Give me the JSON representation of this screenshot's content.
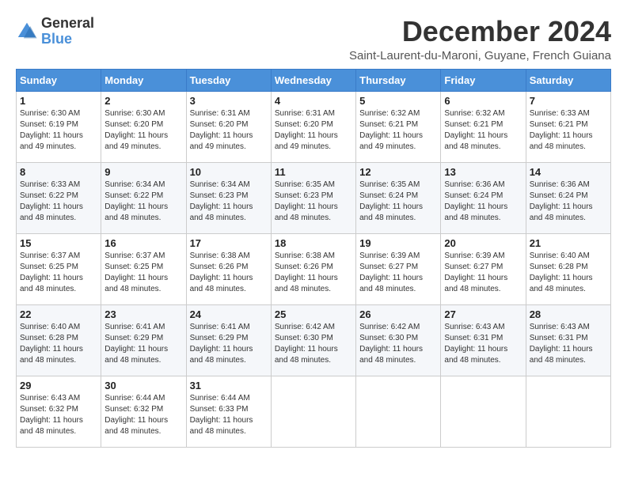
{
  "logo": {
    "general": "General",
    "blue": "Blue"
  },
  "title": "December 2024",
  "subtitle": "Saint-Laurent-du-Maroni, Guyane, French Guiana",
  "days_of_week": [
    "Sunday",
    "Monday",
    "Tuesday",
    "Wednesday",
    "Thursday",
    "Friday",
    "Saturday"
  ],
  "weeks": [
    [
      {
        "day": "1",
        "sunrise": "6:30 AM",
        "sunset": "6:19 PM",
        "daylight": "11 hours and 49 minutes."
      },
      {
        "day": "2",
        "sunrise": "6:30 AM",
        "sunset": "6:20 PM",
        "daylight": "11 hours and 49 minutes."
      },
      {
        "day": "3",
        "sunrise": "6:31 AM",
        "sunset": "6:20 PM",
        "daylight": "11 hours and 49 minutes."
      },
      {
        "day": "4",
        "sunrise": "6:31 AM",
        "sunset": "6:20 PM",
        "daylight": "11 hours and 49 minutes."
      },
      {
        "day": "5",
        "sunrise": "6:32 AM",
        "sunset": "6:21 PM",
        "daylight": "11 hours and 49 minutes."
      },
      {
        "day": "6",
        "sunrise": "6:32 AM",
        "sunset": "6:21 PM",
        "daylight": "11 hours and 48 minutes."
      },
      {
        "day": "7",
        "sunrise": "6:33 AM",
        "sunset": "6:21 PM",
        "daylight": "11 hours and 48 minutes."
      }
    ],
    [
      {
        "day": "8",
        "sunrise": "6:33 AM",
        "sunset": "6:22 PM",
        "daylight": "11 hours and 48 minutes."
      },
      {
        "day": "9",
        "sunrise": "6:34 AM",
        "sunset": "6:22 PM",
        "daylight": "11 hours and 48 minutes."
      },
      {
        "day": "10",
        "sunrise": "6:34 AM",
        "sunset": "6:23 PM",
        "daylight": "11 hours and 48 minutes."
      },
      {
        "day": "11",
        "sunrise": "6:35 AM",
        "sunset": "6:23 PM",
        "daylight": "11 hours and 48 minutes."
      },
      {
        "day": "12",
        "sunrise": "6:35 AM",
        "sunset": "6:24 PM",
        "daylight": "11 hours and 48 minutes."
      },
      {
        "day": "13",
        "sunrise": "6:36 AM",
        "sunset": "6:24 PM",
        "daylight": "11 hours and 48 minutes."
      },
      {
        "day": "14",
        "sunrise": "6:36 AM",
        "sunset": "6:24 PM",
        "daylight": "11 hours and 48 minutes."
      }
    ],
    [
      {
        "day": "15",
        "sunrise": "6:37 AM",
        "sunset": "6:25 PM",
        "daylight": "11 hours and 48 minutes."
      },
      {
        "day": "16",
        "sunrise": "6:37 AM",
        "sunset": "6:25 PM",
        "daylight": "11 hours and 48 minutes."
      },
      {
        "day": "17",
        "sunrise": "6:38 AM",
        "sunset": "6:26 PM",
        "daylight": "11 hours and 48 minutes."
      },
      {
        "day": "18",
        "sunrise": "6:38 AM",
        "sunset": "6:26 PM",
        "daylight": "11 hours and 48 minutes."
      },
      {
        "day": "19",
        "sunrise": "6:39 AM",
        "sunset": "6:27 PM",
        "daylight": "11 hours and 48 minutes."
      },
      {
        "day": "20",
        "sunrise": "6:39 AM",
        "sunset": "6:27 PM",
        "daylight": "11 hours and 48 minutes."
      },
      {
        "day": "21",
        "sunrise": "6:40 AM",
        "sunset": "6:28 PM",
        "daylight": "11 hours and 48 minutes."
      }
    ],
    [
      {
        "day": "22",
        "sunrise": "6:40 AM",
        "sunset": "6:28 PM",
        "daylight": "11 hours and 48 minutes."
      },
      {
        "day": "23",
        "sunrise": "6:41 AM",
        "sunset": "6:29 PM",
        "daylight": "11 hours and 48 minutes."
      },
      {
        "day": "24",
        "sunrise": "6:41 AM",
        "sunset": "6:29 PM",
        "daylight": "11 hours and 48 minutes."
      },
      {
        "day": "25",
        "sunrise": "6:42 AM",
        "sunset": "6:30 PM",
        "daylight": "11 hours and 48 minutes."
      },
      {
        "day": "26",
        "sunrise": "6:42 AM",
        "sunset": "6:30 PM",
        "daylight": "11 hours and 48 minutes."
      },
      {
        "day": "27",
        "sunrise": "6:43 AM",
        "sunset": "6:31 PM",
        "daylight": "11 hours and 48 minutes."
      },
      {
        "day": "28",
        "sunrise": "6:43 AM",
        "sunset": "6:31 PM",
        "daylight": "11 hours and 48 minutes."
      }
    ],
    [
      {
        "day": "29",
        "sunrise": "6:43 AM",
        "sunset": "6:32 PM",
        "daylight": "11 hours and 48 minutes."
      },
      {
        "day": "30",
        "sunrise": "6:44 AM",
        "sunset": "6:32 PM",
        "daylight": "11 hours and 48 minutes."
      },
      {
        "day": "31",
        "sunrise": "6:44 AM",
        "sunset": "6:33 PM",
        "daylight": "11 hours and 48 minutes."
      },
      null,
      null,
      null,
      null
    ]
  ]
}
